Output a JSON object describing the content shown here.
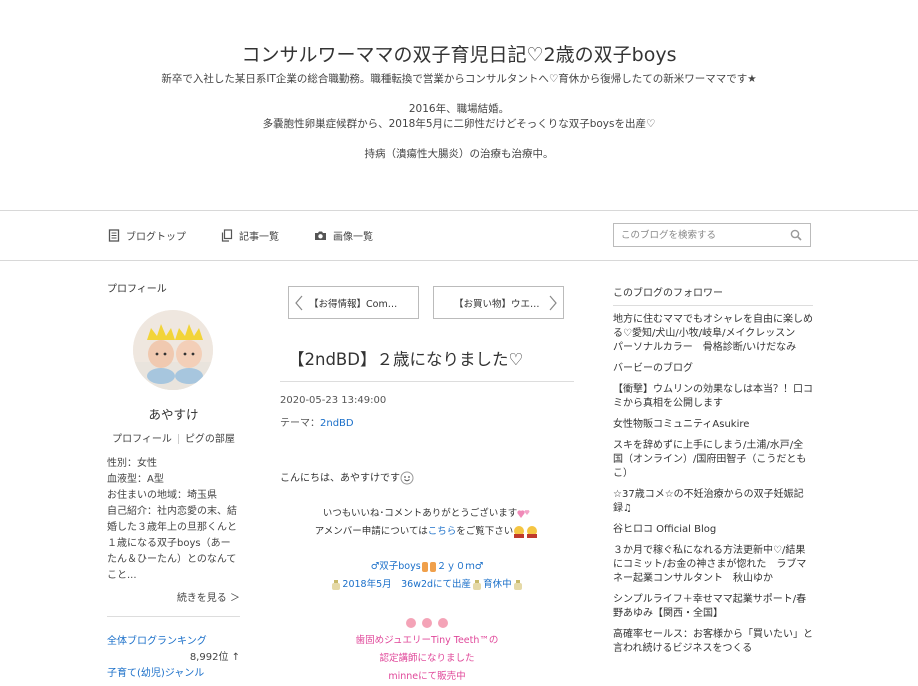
{
  "header": {
    "title": "コンサルワーママの双子育児日記♡2歳の双子boys",
    "desc_line1": "新卒で入社した某日系IT企業の総合職勤務。職種転換で営業からコンサルタントへ♡育休から復帰したての新米ワーママです★",
    "desc_line2": "2016年、職場結婚。",
    "desc_line3": "多嚢胞性卵巣症候群から、2018年5月に二卵性だけどそっくりな双子boysを出産♡",
    "desc_line4": "持病（潰瘍性大腸炎）の治療も治療中。"
  },
  "nav": {
    "top": "ブログトップ",
    "list": "記事一覧",
    "images": "画像一覧",
    "search_placeholder": "このブログを検索する"
  },
  "profile": {
    "heading": "プロフィール",
    "nickname": "あやすけ",
    "link_profile": "プロフィール",
    "link_pigg": "ピグの部屋",
    "gender": "性別：女性",
    "blood": "血液型：A型",
    "area": "お住まいの地域：埼玉県",
    "intro": "自己紹介：社内恋愛の末、結婚した３歳年上の旦那くんと１歳になる双子boys（あーたん＆ひーたん）とのなんてこと...",
    "more": "続きを見る ＞",
    "ranking_link": "全体ブログランキング",
    "ranking_num": "8,992位 ↑",
    "genre_link": "子育て(幼児)ジャンル"
  },
  "pager": {
    "prev": "【お得情報】Com…",
    "next": "【お買い物】ウエ…"
  },
  "entry": {
    "title": "【2ndBD】２歳になりました♡",
    "date": "2020-05-23 13:49:00",
    "theme_label": "テーマ：",
    "theme": "2ndBD",
    "hello": "こんにちは、あやすけです",
    "thanks": "いつもいいね･コメントありがとうございます",
    "amember_pre": "アメンバー申請については",
    "amember_link": "こちら",
    "amember_post": "をご覧下さい",
    "twins": "双子boys",
    "twins_age": "２ｙ０ｍ",
    "birth": "2018年5月　36w2dにて出産",
    "ikukyu": "育休中",
    "jewelry1": "歯固めジュエリーTiny Teeth™の",
    "jewelry2": "認定講師になりました",
    "jewelry3": "minneにて販売中"
  },
  "followers": {
    "heading": "このブログのフォロワー",
    "items": [
      "地方に住むママでもオシャレを自由に楽しめる♡愛知/犬山/小牧/岐阜/メイクレッスン　パーソナルカラー　骨格診断/いけだなみ",
      "バービーのブログ",
      "【衝撃】ウムリンの効果なしは本当？！口コミから真相を公開します",
      "女性物販コミュニティAsukire",
      "スキを辞めずに上手にしまう/土浦/水戸/全国（オンライン）/国府田智子（こうだともこ）",
      "☆37歳コメ☆の不妊治療からの双子妊娠記録♫",
      "谷ヒロコ Official Blog",
      "３か月で稼ぐ私になれる方法更新中♡/結果にコミット/お金の神さまが惚れた　ラブマネー起業コンサルタント　秋山ゆか",
      "シンプルライフ＋幸せママ起業サポート/春野あゆみ【関西・全国】",
      "高確率セールス：お客様から「買いたい」と言われ続けるビジネスをつくる"
    ]
  },
  "colors": {
    "link": "#1a6fc9",
    "pink": "#e0489a"
  }
}
